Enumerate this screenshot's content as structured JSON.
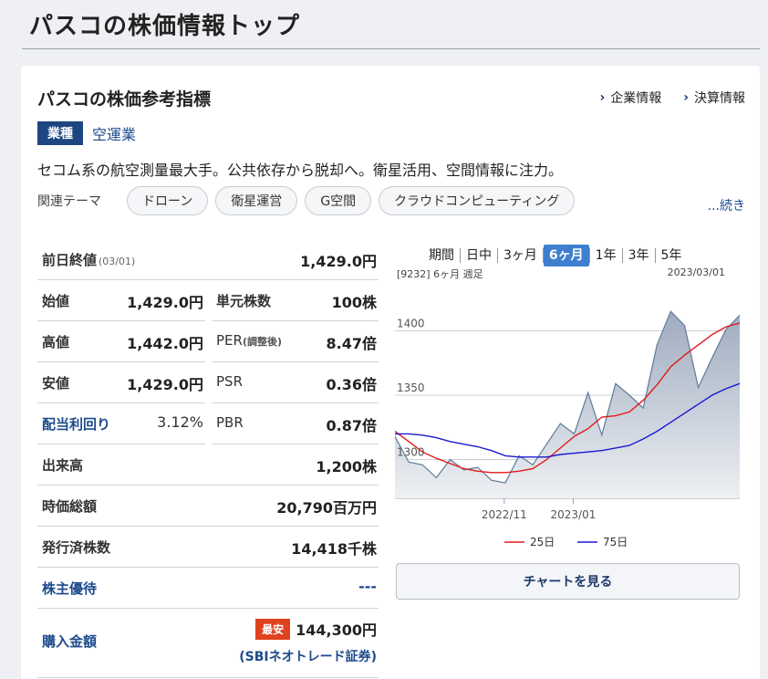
{
  "page": {
    "title": "パスコの株価情報トップ"
  },
  "card": {
    "title": "パスコの株価参考指標",
    "links": {
      "company_info": "企業情報",
      "earnings_info": "決算情報"
    },
    "sector": {
      "badge": "業種",
      "name": "空運業"
    },
    "description": "セコム系の航空測量最大手。公共依存から脱却へ。衛星活用、空間情報に注力。",
    "themes": {
      "label": "関連テーマ",
      "tags": [
        "ドローン",
        "衛星運営",
        "G空間",
        "クラウドコンピューティング"
      ],
      "more": "...続き"
    }
  },
  "metrics": {
    "prev_close": {
      "label": "前日終値",
      "date": "(03/01)",
      "value": "1,429.0円"
    },
    "open": {
      "label": "始値",
      "value": "1,429.0円"
    },
    "unit": {
      "label": "単元株数",
      "value": "100株"
    },
    "high": {
      "label": "高値",
      "value": "1,442.0円"
    },
    "per": {
      "label": "PER",
      "sub": "(調整後)",
      "value": "8.47倍"
    },
    "low": {
      "label": "安値",
      "value": "1,429.0円"
    },
    "psr": {
      "label": "PSR",
      "value": "0.36倍"
    },
    "dividend": {
      "label": "配当利回り",
      "value": "3.12%"
    },
    "pbr": {
      "label": "PBR",
      "value": "0.87倍"
    },
    "volume": {
      "label": "出来高",
      "value": "1,200株"
    },
    "market_cap": {
      "label": "時価総額",
      "value": "20,790百万円"
    },
    "shares": {
      "label": "発行済株数",
      "value": "14,418千株"
    },
    "benefits": {
      "label": "株主優待",
      "value": "---"
    },
    "purchase": {
      "label": "購入金額",
      "badge": "最安",
      "value": "144,300円",
      "broker": "(SBIネオトレード証券)"
    }
  },
  "chart": {
    "tabs": [
      "期間",
      "日中",
      "3ヶ月",
      "6ヶ月",
      "1年",
      "3年",
      "5年"
    ],
    "active_tab": "6ヶ月",
    "code_label": "[9232] 6ヶ月 週足",
    "date_label": "2023/03/01",
    "button_label": "チャートを見る",
    "legend": {
      "ma25": "25日",
      "ma75": "75日"
    }
  },
  "chart_data": {
    "type": "line",
    "y_ticks": [
      "1400",
      "1350",
      "1300"
    ],
    "x_ticks": [
      "2022/11",
      "2023/01"
    ],
    "ylim": [
      1270,
      1430
    ],
    "series": [
      {
        "name": "price",
        "color": "#5f7a9a",
        "values": [
          1318,
          1298,
          1296,
          1286,
          1300,
          1292,
          1294,
          1284,
          1282,
          1303,
          1296,
          1312,
          1328,
          1320,
          1352,
          1319,
          1359,
          1350,
          1340,
          1389,
          1415,
          1404,
          1356,
          1379,
          1401,
          1412
        ]
      },
      {
        "name": "25日",
        "color": "#e01a1a",
        "values": [
          1322,
          1314,
          1306,
          1301,
          1297,
          1293,
          1291,
          1290,
          1290,
          1291,
          1293,
          1300,
          1309,
          1318,
          1324,
          1333,
          1334,
          1337,
          1346,
          1358,
          1372,
          1381,
          1389,
          1397,
          1403,
          1406
        ]
      },
      {
        "name": "75日",
        "color": "#1a1ad0",
        "values": [
          1320,
          1320,
          1319,
          1317,
          1314,
          1312,
          1310,
          1307,
          1303,
          1302,
          1302,
          1302,
          1304,
          1305,
          1306,
          1307,
          1309,
          1311,
          1316,
          1322,
          1329,
          1336,
          1343,
          1350,
          1355,
          1359
        ]
      }
    ]
  }
}
